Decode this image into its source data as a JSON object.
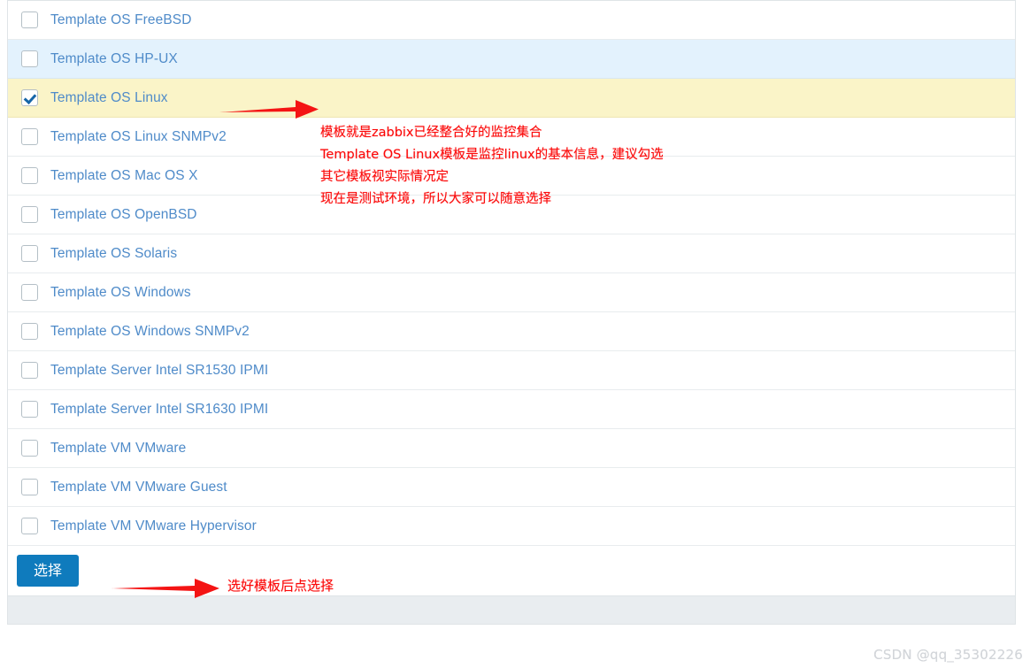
{
  "table": {
    "rows": [
      {
        "label": "Template OS FreeBSD",
        "checked": false,
        "state": "normal"
      },
      {
        "label": "Template OS HP-UX",
        "checked": false,
        "state": "hover"
      },
      {
        "label": "Template OS Linux",
        "checked": true,
        "state": "checked"
      },
      {
        "label": "Template OS Linux SNMPv2",
        "checked": false,
        "state": "normal"
      },
      {
        "label": "Template OS Mac OS X",
        "checked": false,
        "state": "normal"
      },
      {
        "label": "Template OS OpenBSD",
        "checked": false,
        "state": "normal"
      },
      {
        "label": "Template OS Solaris",
        "checked": false,
        "state": "normal"
      },
      {
        "label": "Template OS Windows",
        "checked": false,
        "state": "normal"
      },
      {
        "label": "Template OS Windows SNMPv2",
        "checked": false,
        "state": "normal"
      },
      {
        "label": "Template Server Intel SR1530 IPMI",
        "checked": false,
        "state": "normal"
      },
      {
        "label": "Template Server Intel SR1630 IPMI",
        "checked": false,
        "state": "normal"
      },
      {
        "label": "Template VM VMware",
        "checked": false,
        "state": "normal"
      },
      {
        "label": "Template VM VMware Guest",
        "checked": false,
        "state": "normal"
      },
      {
        "label": "Template VM VMware Hypervisor",
        "checked": false,
        "state": "normal"
      }
    ]
  },
  "footer": {
    "select_label": "选择"
  },
  "annotations": {
    "template_note": "模板就是zabbix已经整合好的监控集合\nTemplate OS Linux模板是监控linux的基本信息，建议勾选\n其它模板视实际情况定\n现在是测试环境，所以大家可以随意选择",
    "bottom_note": "选好模板后点选择"
  },
  "watermark": {
    "line1": "CSDN @qq_35302226",
    "line2": "CSDN @qq_35302226"
  },
  "colors": {
    "link": "#4f8bc9",
    "checked_row": "#faf4c8",
    "hover_row": "#e3f2fd",
    "button": "#0f7bbd",
    "annotation": "#fb0909"
  }
}
